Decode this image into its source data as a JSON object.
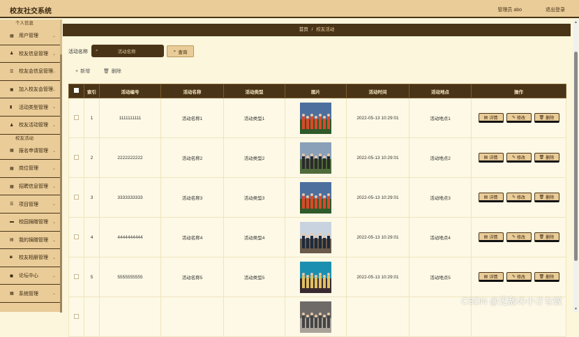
{
  "header": {
    "title": "校友社交系统",
    "user": "管理员 abo",
    "logout": "退出登录"
  },
  "sidebar": {
    "group1": "个人信息",
    "items_a": [
      {
        "icon": "grid-icon",
        "glyph": "▦",
        "label": "用户管理"
      },
      {
        "icon": "person-icon",
        "glyph": "♟",
        "label": "校友信息管理"
      },
      {
        "icon": "list-icon",
        "glyph": "☰",
        "label": "校友会信息管理"
      },
      {
        "icon": "calendar-icon",
        "glyph": "▣",
        "label": "加入校友会管理"
      },
      {
        "icon": "bar-chart-icon",
        "glyph": "▮",
        "label": "活动类型管理"
      },
      {
        "icon": "person-icon",
        "glyph": "♟",
        "label": "校友活动管理"
      }
    ],
    "group2": "校友活动",
    "items_b": [
      {
        "icon": "grid-icon",
        "glyph": "▦",
        "label": "报名申请管理"
      },
      {
        "icon": "grid-icon",
        "glyph": "▦",
        "label": "岗位管理"
      },
      {
        "icon": "grid-icon",
        "glyph": "▦",
        "label": "招聘信息管理"
      },
      {
        "icon": "list-icon",
        "glyph": "☰",
        "label": "项目管理"
      },
      {
        "icon": "chat-icon",
        "glyph": "▬",
        "label": "校园捐赠管理"
      },
      {
        "icon": "document-icon",
        "glyph": "▤",
        "label": "我的捐赠管理"
      },
      {
        "icon": "video-icon",
        "glyph": "◙",
        "label": "校友相册管理"
      },
      {
        "icon": "forum-icon",
        "glyph": "◼",
        "label": "论坛中心"
      },
      {
        "icon": "gear-icon",
        "glyph": "▦",
        "label": "系统管理"
      }
    ]
  },
  "breadcrumb": {
    "home": "首页",
    "sep": "/",
    "current": "校友活动"
  },
  "search": {
    "label": "活动名称",
    "placeholder": "活动名称",
    "button": "查询"
  },
  "toolbar": {
    "add": "新增",
    "delete": "删除"
  },
  "table": {
    "headers": [
      "索引",
      "活动编号",
      "活动名称",
      "活动类型",
      "图片",
      "活动时间",
      "活动地点",
      "操作"
    ],
    "rows": [
      {
        "idx": "1",
        "code": "1111111111",
        "name": "活动名称1",
        "type": "活动类型1",
        "time": "2022-05-13 10:29:01",
        "place": "活动地点1"
      },
      {
        "idx": "2",
        "code": "2222222222",
        "name": "活动名称2",
        "type": "活动类型2",
        "time": "2022-05-13 10:29:01",
        "place": "活动地点2"
      },
      {
        "idx": "3",
        "code": "3333333333",
        "name": "活动名称3",
        "type": "活动类型3",
        "time": "2022-05-13 10:29:01",
        "place": "活动地点3"
      },
      {
        "idx": "4",
        "code": "4444444444",
        "name": "活动名称4",
        "type": "活动类型4",
        "time": "2022-05-13 10:29:01",
        "place": "活动地点4"
      },
      {
        "idx": "5",
        "code": "5555555555",
        "name": "活动名称5",
        "type": "活动类型5",
        "time": "2022-05-13 10:29:01",
        "place": "活动地点5"
      },
      {
        "idx": "",
        "code": "",
        "name": "",
        "type": "",
        "time": "",
        "place": ""
      }
    ],
    "ops": {
      "detail": "详情",
      "edit": "修改",
      "delete": "删除"
    }
  },
  "watermark": "CSDN @无敌の小さな蚊",
  "colors": {
    "brown": "#4a3417",
    "tan": "#e9cc98",
    "page": "#fbf6dc"
  }
}
